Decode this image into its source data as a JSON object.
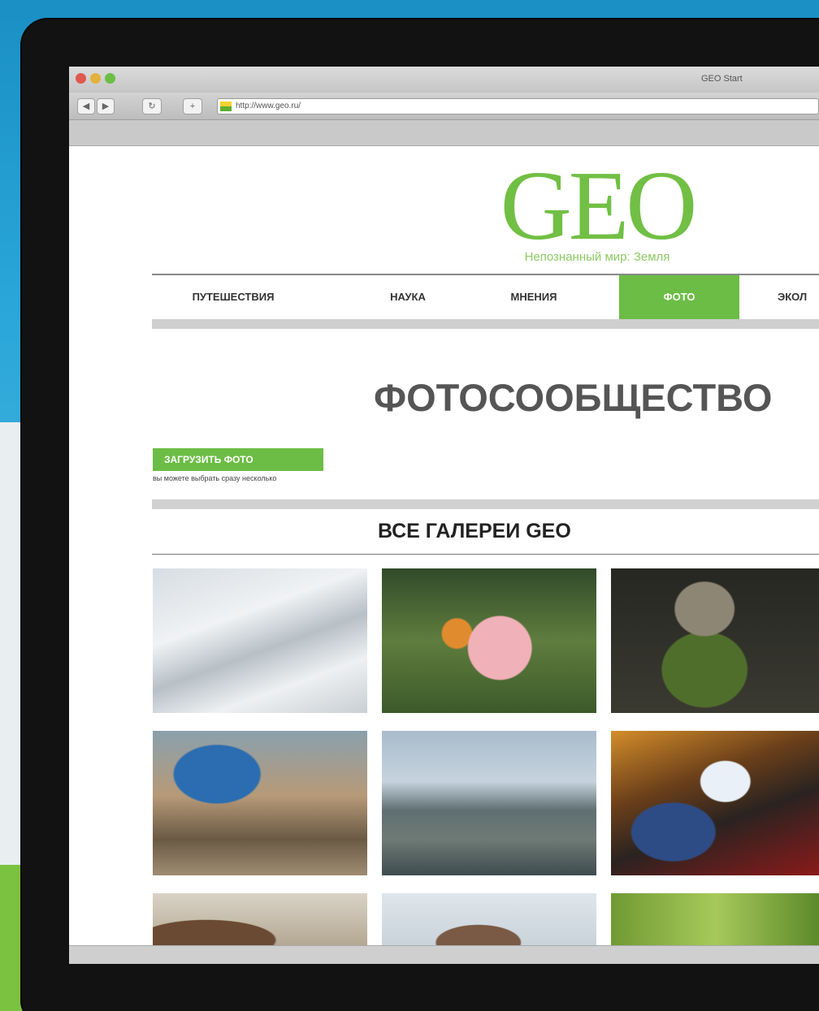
{
  "browser": {
    "window_title": "GEO Start",
    "url": "http://www.geo.ru/",
    "buttons": {
      "back": "◀",
      "forward": "▶",
      "reload": "↻",
      "add": "+"
    }
  },
  "site": {
    "logo": "GEO",
    "tagline": "Непознанный мир: Земля",
    "nav": [
      {
        "label": "ПУТЕШЕСТВИЯ"
      },
      {
        "label": "НАУКА"
      },
      {
        "label": "МНЕНИЯ"
      },
      {
        "label": "ФОТО",
        "active": true
      },
      {
        "label": "ЭКОЛ"
      }
    ],
    "page_title": "ФОТОСООБЩЕСТВО",
    "upload": {
      "button_label": "ЗАГРУЗИТЬ ФОТО",
      "hint": "вы можете выбрать сразу несколько"
    },
    "section_title": "ВСЕ ГАЛЕРЕИ GEO",
    "gallery": [
      {
        "icon": "snow-mountain-photo"
      },
      {
        "icon": "child-portrait-photo"
      },
      {
        "icon": "vulture-photo"
      },
      {
        "icon": "harbor-seals-photo"
      },
      {
        "icon": "mountain-city-photo"
      },
      {
        "icon": "festival-costume-photo"
      },
      {
        "icon": "group-photo"
      },
      {
        "icon": "tent-photo"
      },
      {
        "icon": "forest-photo"
      }
    ]
  },
  "colors": {
    "brand_green": "#71bf44",
    "nav_active": "#6cbd45",
    "background_blue": "#2aa6d8"
  }
}
